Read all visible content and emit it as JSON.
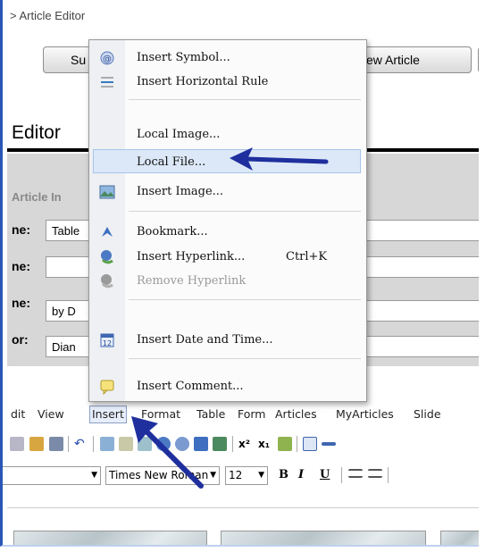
{
  "breadcrumb": "> Article Editor",
  "buttons": {
    "left_partial": "Su",
    "mid_partial": "ew Article",
    "right_partial": ""
  },
  "editor": {
    "title_partial": "Editor",
    "panel_legend_partial": "Article In"
  },
  "fields": [
    {
      "label": "ne:",
      "value": "Table"
    },
    {
      "label": "ne:",
      "value": ""
    },
    {
      "label": "ne:",
      "value": "by D"
    },
    {
      "label": "or:",
      "value": "Dian"
    }
  ],
  "menubar": [
    "dit",
    "View",
    "Insert",
    "Format",
    "Table",
    "Form",
    "Articles",
    "MyArticles",
    "Slide"
  ],
  "toolbar2": {
    "font": "Times New Roman",
    "size": "12",
    "bold": "B",
    "italic": "I",
    "underline": "U"
  },
  "insert_menu": {
    "items": [
      {
        "label": "Insert Symbol...",
        "icon": "symbol-icon"
      },
      {
        "label": "Insert Horizontal Rule",
        "icon": "horizontal-rule-icon"
      },
      {
        "label": "Local Image...",
        "icon": ""
      },
      {
        "label": "Local File...",
        "icon": "",
        "highlighted": true
      },
      {
        "label": "Insert Image...",
        "icon": "image-icon"
      },
      {
        "label": "Bookmark...",
        "icon": "bookmark-icon"
      },
      {
        "label": "Insert Hyperlink...",
        "icon": "hyperlink-icon",
        "shortcut": "Ctrl+K"
      },
      {
        "label": "Remove Hyperlink",
        "icon": "remove-hyperlink-icon",
        "disabled": true
      },
      {
        "label": "Insert Date and Time...",
        "icon": "calendar-icon"
      },
      {
        "label": "Insert Comment...",
        "icon": "comment-icon"
      }
    ]
  },
  "colors": {
    "accent_arrow": "#1f2f9e",
    "menu_highlight": "#dce8f7",
    "frame_border": "#2a55b8"
  }
}
